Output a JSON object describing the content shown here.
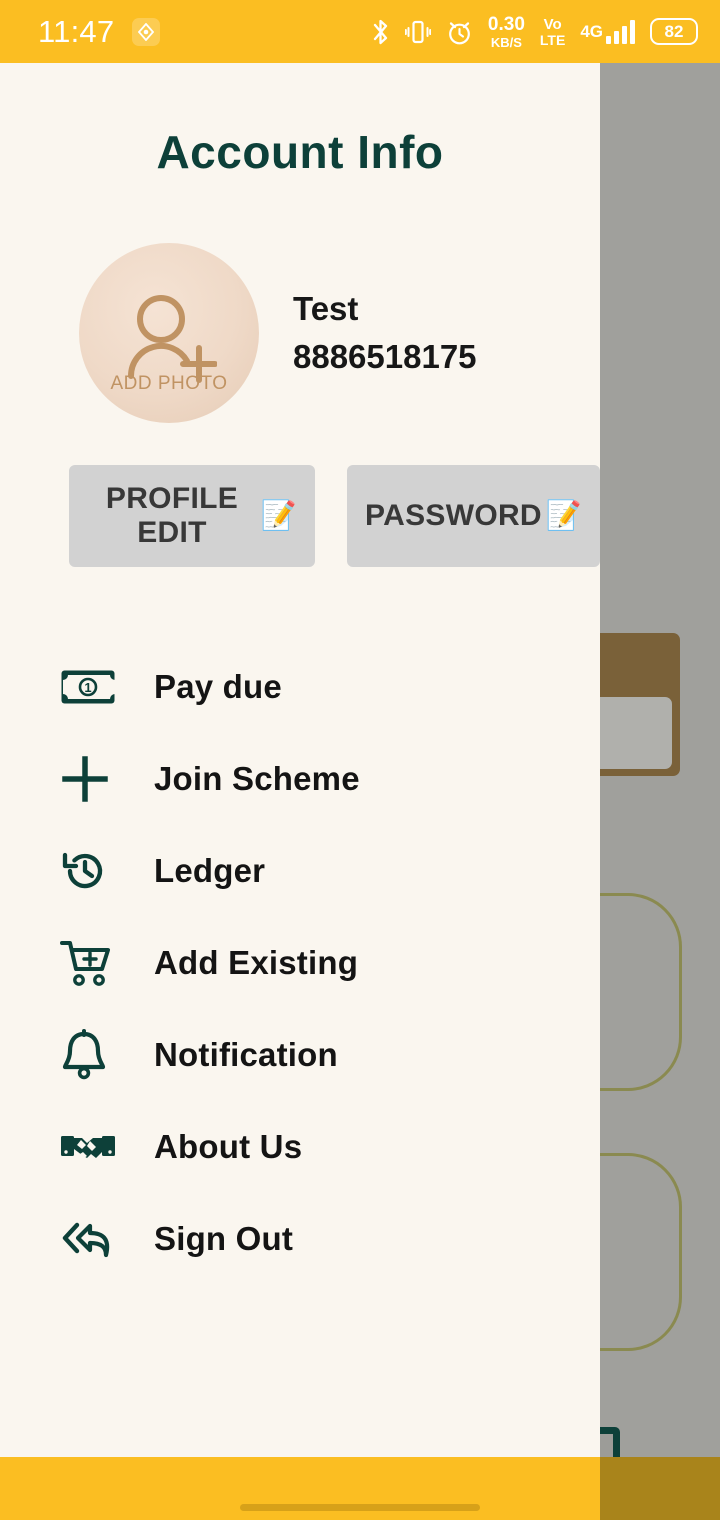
{
  "status_bar": {
    "time": "11:47",
    "location_icon": "location-diamond-icon",
    "bluetooth_icon": "bluetooth-icon",
    "vibrate_icon": "vibrate-icon",
    "alarm_icon": "alarm-clock-icon",
    "net_speed_value": "0.30",
    "net_speed_unit": "KB/S",
    "volte_top": "Vo",
    "volte_bottom": "LTE",
    "network_type": "4G",
    "signal_icon": "signal-bars-icon",
    "battery_level": "82"
  },
  "drawer": {
    "title": "Account Info",
    "avatar": {
      "icon": "add-person-icon",
      "label": "ADD PHOTO"
    },
    "profile": {
      "name": "Test",
      "phone": "8886518175"
    },
    "buttons": [
      {
        "label": "PROFILE EDIT",
        "icon": "memo-pencil-icon",
        "glyph": "📝"
      },
      {
        "label": "PASSWORD",
        "icon": "memo-pencil-icon",
        "glyph": "📝"
      }
    ],
    "menu": [
      {
        "label": "Pay due",
        "icon": "banknote-icon"
      },
      {
        "label": "Join Scheme",
        "icon": "plus-icon"
      },
      {
        "label": "Ledger",
        "icon": "history-clock-icon"
      },
      {
        "label": "Add Existing",
        "icon": "cart-plus-icon"
      },
      {
        "label": "Notification",
        "icon": "bell-icon"
      },
      {
        "label": "About Us",
        "icon": "handshake-icon"
      },
      {
        "label": "Sign Out",
        "icon": "reply-back-arrow-icon"
      }
    ]
  },
  "colors": {
    "status_bar": "#fbbe22",
    "drawer_bg": "#faf6ef",
    "accent_teal": "#0d4039",
    "scrim": "#a0a09c",
    "button_gray": "#d2d2d2",
    "avatar_tan": "#c09363",
    "bottom_bar": "#fbbe22"
  }
}
